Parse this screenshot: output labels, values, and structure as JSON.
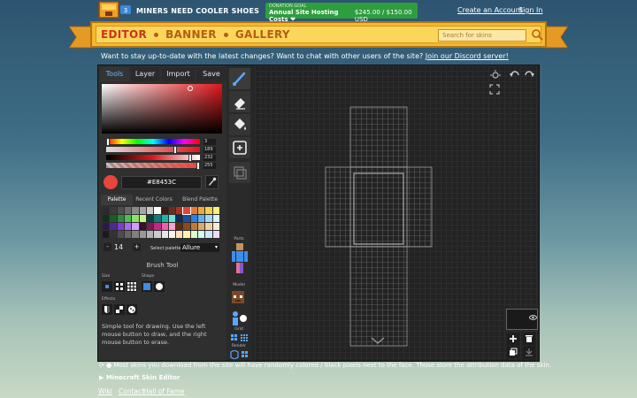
{
  "header": {
    "site_name": "MINERS NEED COOLER SHOES",
    "donation_label": "DONATION GOAL",
    "donation_title": "Annual Site Hosting Costs ❤",
    "donation_amount": "$245.00 / $150.00 USD",
    "create_account": "Create an Account",
    "sign_in": "Sign In"
  },
  "nav": {
    "editor": "EDITOR",
    "banner": "BANNER",
    "gallery": "GALLERY",
    "search_placeholder": "Search for skins"
  },
  "discord_message": {
    "text": "Want to stay up-to-date with the latest changes? Want to chat with other users of the site?",
    "link": "Join our Discord server!"
  },
  "tabs": [
    "Tools",
    "Layer",
    "Import",
    "Save"
  ],
  "color": {
    "values": [
      "3",
      "189",
      "232",
      "255"
    ],
    "hex": "#E8453C",
    "current": "#e8453c"
  },
  "palette_tabs": [
    "Palette",
    "Recent Colors",
    "Blend Palette"
  ],
  "palette_colors": [
    "#2b2b2b",
    "#3a3a3a",
    "#4e4e4e",
    "#6a6a6a",
    "#8a8a8a",
    "#a6a6a6",
    "#c8c8c8",
    "#ffffff",
    "#3b1d14",
    "#6b2c1f",
    "#a8341e",
    "#e0443b",
    "#e97a36",
    "#f0a93a",
    "#f4d24b",
    "#f7f07a",
    "#132e1a",
    "#1e5a2a",
    "#2f8a3b",
    "#4cbf53",
    "#8ee36b",
    "#c9f28a",
    "#0f3b3f",
    "#137a78",
    "#1fb4a6",
    "#6fe0d2",
    "#0e2b5a",
    "#1b4fa0",
    "#2f7fe3",
    "#5fb2f4",
    "#9fd8fa",
    "#d8f1fb",
    "#2a1a4a",
    "#4b2b8a",
    "#7a3fcf",
    "#a66bee",
    "#d09ef7",
    "#3b0e2a",
    "#7a1a55",
    "#c02a86",
    "#ee5cb0",
    "#f7a3d1",
    "#5a2e12",
    "#8a4a1e",
    "#c07a3a",
    "#e0a86b",
    "#f2d0a2",
    "#fbead2",
    "#1a1a1a",
    "#333333",
    "#4d4d4d",
    "#666666",
    "#808080",
    "#999999",
    "#b3b3b3",
    "#cccccc",
    "#e6e6e6",
    "#ffefef",
    "#ffe0c0",
    "#fff5b0",
    "#e0ffd0",
    "#d0fff5",
    "#d0e6ff",
    "#f0d8ff"
  ],
  "zoom": {
    "minus": "-",
    "value": "14",
    "plus": "+",
    "select_label": "Select palette",
    "selected_palette": "Allure"
  },
  "brush": {
    "title": "Brush Tool",
    "size_label": "Size",
    "shape_label": "Shape",
    "effects_label": "Effects",
    "description": "Simple tool for drawing. Use the left mouse button to draw, and the right mouse button to erase."
  },
  "side_labels": {
    "parts": "Parts",
    "model": "Model",
    "grid": "Grid",
    "render": "Render"
  },
  "footer": {
    "notice": "Most skins you download from the site will have randomly colored / black pixels next to the face. Those store the attribution data of the skin.",
    "skin_editor": "Minecraft Skin Editor",
    "wiki": "Wiki",
    "contact": "Contact",
    "hall_of_fame": "Hall of Fame"
  }
}
